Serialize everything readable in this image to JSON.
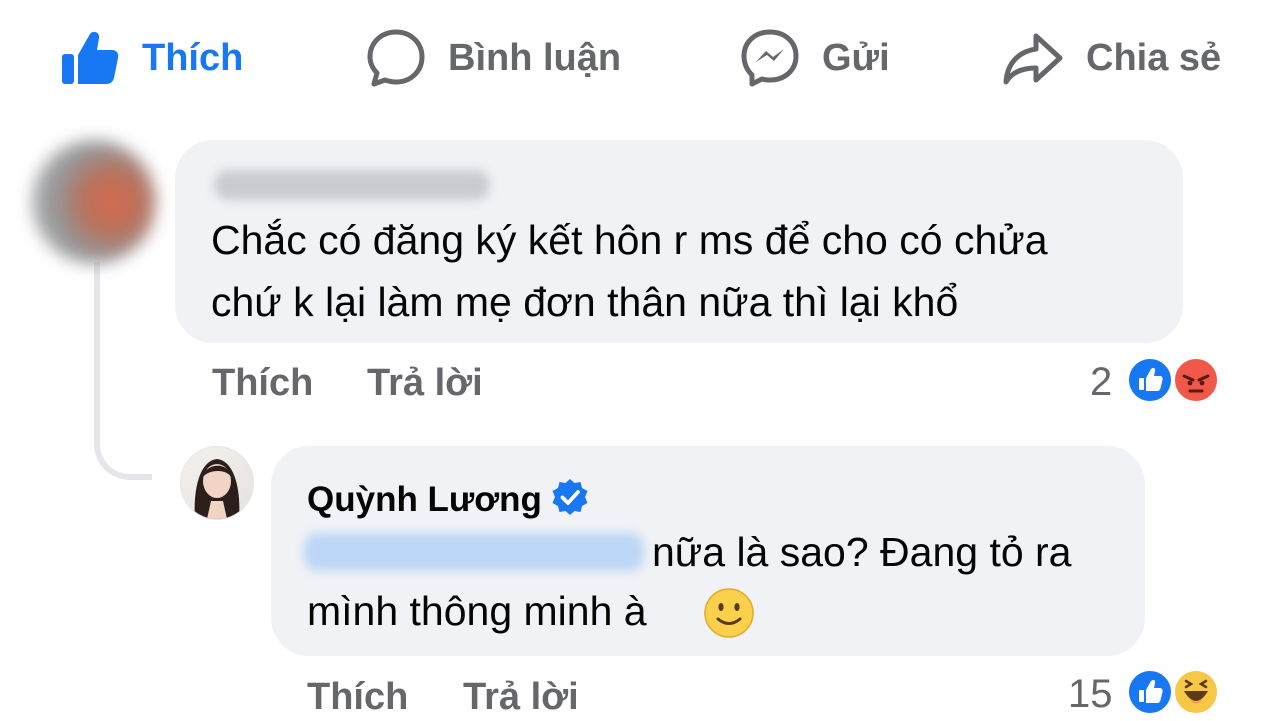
{
  "actions": {
    "like": "Thích",
    "comment": "Bình luận",
    "send": "Gửi",
    "share": "Chia sẻ"
  },
  "comment_1": {
    "line1": "Chắc có đăng ký kết hôn r ms để cho có chửa",
    "line2": "chứ k lại làm mẹ đơn thân nữa thì lại khổ",
    "like": "Thích",
    "reply": "Trả lời",
    "reaction_count": "2",
    "reactions": [
      "like-icon",
      "angry-icon"
    ]
  },
  "reply_1": {
    "author": "Quỳnh Lương",
    "line1_suffix": "nữa là sao? Đang tỏ ra",
    "line2": "mình thông minh à",
    "emoji": "🙂",
    "like": "Thích",
    "reply": "Trả lời",
    "reaction_count": "15",
    "reactions": [
      "like-icon",
      "haha-icon"
    ]
  },
  "colors": {
    "brand": "#1877f2",
    "muted": "#65676b",
    "bubble": "#f0f2f5",
    "angry": "#f0594a",
    "haha": "#f7c845"
  }
}
